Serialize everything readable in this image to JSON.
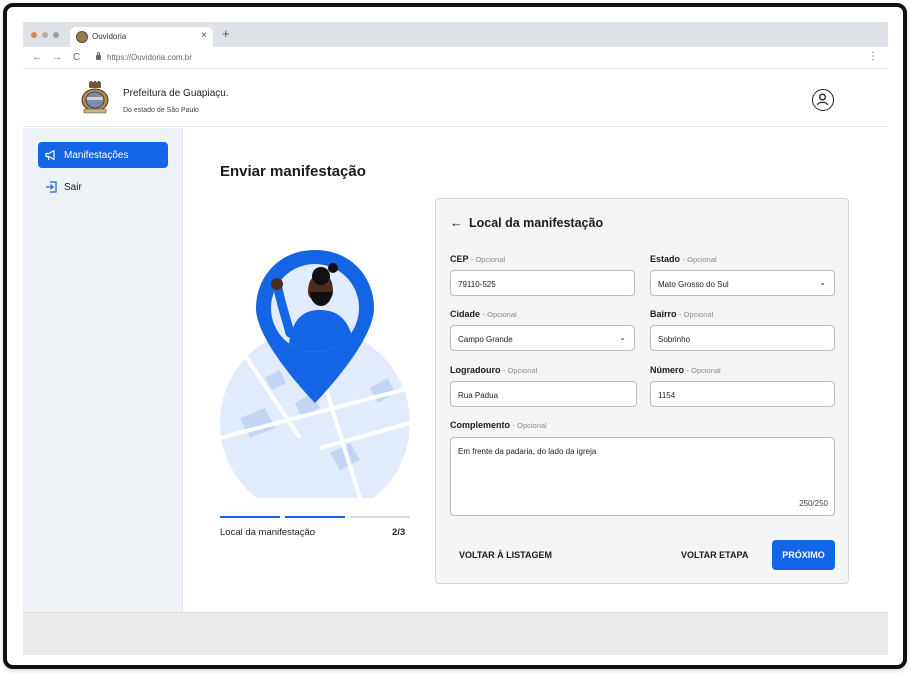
{
  "browser": {
    "tab_title": "Ouvidoria",
    "tab_close": "×",
    "new_tab": "+",
    "back": "←",
    "forward": "→",
    "reload": "C",
    "url": "https://Ouvidoria.com.br",
    "menu": "⋮"
  },
  "header": {
    "title": "Prefeitura de Guapiaçu.",
    "subtitle": "Do estado de São Paulo"
  },
  "sidebar": {
    "items": [
      {
        "label": "Manifestações",
        "icon": "megaphone-icon"
      },
      {
        "label": "Sair",
        "icon": "logout-icon"
      }
    ]
  },
  "main": {
    "title": "Enviar manifestação",
    "step_label": "Local da manifestação",
    "step_count": "2/3",
    "progress": {
      "current": 2,
      "total": 3
    }
  },
  "form": {
    "back": "←",
    "title": "Local da manifestação",
    "optional": "- Opcional",
    "fields": {
      "cep": {
        "label": "CEP",
        "value": "79110-525"
      },
      "estado": {
        "label": "Estado",
        "value": "Mato Grosso do Sul"
      },
      "cidade": {
        "label": "Cidade",
        "value": "Campo Grande"
      },
      "bairro": {
        "label": "Bairro",
        "value": "Sobrinho"
      },
      "logradouro": {
        "label": "Logradouro",
        "value": "Rua Padua"
      },
      "numero": {
        "label": "Número",
        "value": "1154"
      },
      "complemento": {
        "label": "Complemento",
        "value": "Em frente da padaria, do lado da igreja",
        "counter": "250/250"
      }
    },
    "buttons": {
      "back_to_list": "VOLTAR À LISTAGEM",
      "back_step": "VOLTAR ETAPA",
      "next": "PRÓXIMO"
    }
  },
  "colors": {
    "primary": "#1465e6",
    "map_light": "#e2ebfb",
    "map_mid": "#c3d4f5"
  }
}
